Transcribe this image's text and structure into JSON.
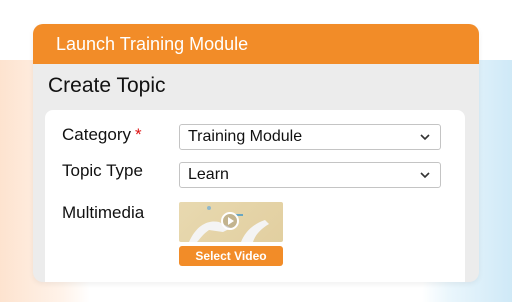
{
  "window": {
    "title": "Launch Training Module"
  },
  "page": {
    "heading": "Create Topic"
  },
  "form": {
    "category": {
      "label": "Category",
      "required_mark": "*",
      "value": "Training Module"
    },
    "topic_type": {
      "label": "Topic Type",
      "value": "Learn"
    },
    "multimedia": {
      "label": "Multimedia",
      "button_label": "Select Video",
      "thumbnail_icon": "play-icon"
    }
  },
  "colors": {
    "accent": "#f28c28",
    "required": "#dd1111"
  }
}
